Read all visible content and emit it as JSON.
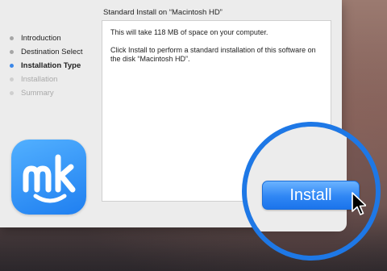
{
  "installer": {
    "steps": [
      {
        "label": "Introduction",
        "state": "done"
      },
      {
        "label": "Destination Select",
        "state": "done"
      },
      {
        "label": "Installation Type",
        "state": "current"
      },
      {
        "label": "Installation",
        "state": "future"
      },
      {
        "label": "Summary",
        "state": "future"
      }
    ],
    "content_title": "Standard Install on “Macintosh HD”",
    "content_paragraphs": [
      "This will take 118 MB of space on your computer.",
      "Click Install to perform a standard installation of this software on the disk “Macintosh HD”."
    ],
    "install_label": "Install",
    "logo_icon": "mk-app-logo-icon"
  },
  "colors": {
    "accent": "#1e78e6",
    "window_bg": "#ececec",
    "step_current_dot": "#3b87e8"
  }
}
